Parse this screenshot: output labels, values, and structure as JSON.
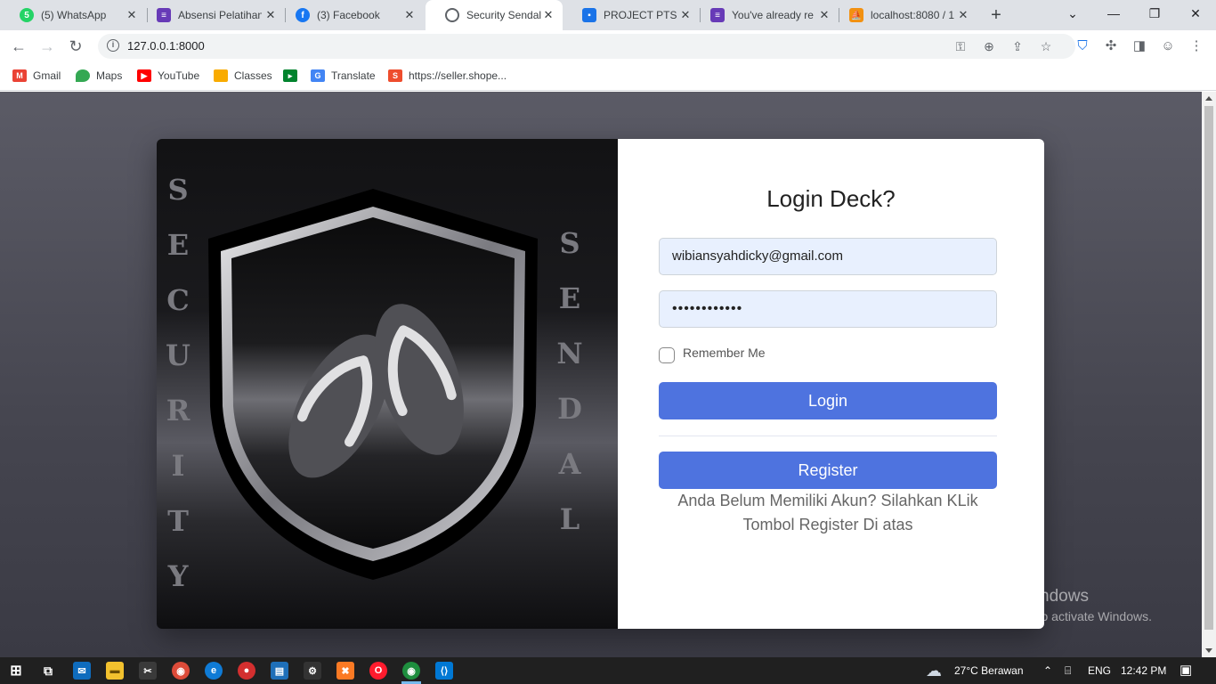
{
  "browser": {
    "tabs": [
      {
        "title": "(5) WhatsApp",
        "favicon": "whatsapp-icon",
        "color": "#25d366"
      },
      {
        "title": "Absensi Pelatihan",
        "favicon": "forms-icon",
        "color": "#673ab7"
      },
      {
        "title": "(3) Facebook",
        "favicon": "facebook-icon",
        "color": "#1877f2"
      },
      {
        "title": "Security Sendal",
        "favicon": "globe-icon",
        "color": "#5f6368",
        "active": true
      },
      {
        "title": "PROJECT PTS",
        "favicon": "classroom-icon",
        "color": "#1a73e8"
      },
      {
        "title": "You've already re",
        "favicon": "forms-icon",
        "color": "#673ab7"
      },
      {
        "title": "localhost:8080 / 1",
        "favicon": "phpmyadmin-icon",
        "color": "#f29111"
      }
    ],
    "new_tab": "+",
    "window_controls": {
      "tab_search": "⌄",
      "minimize": "—",
      "restore": "❐",
      "close": "✕"
    },
    "address": "127.0.0.1:8000",
    "bookmarks": [
      {
        "label": "Gmail",
        "icon": "gmail-icon",
        "color": "#ea4335"
      },
      {
        "label": "Maps",
        "icon": "maps-icon",
        "color": "#34a853"
      },
      {
        "label": "YouTube",
        "icon": "youtube-icon",
        "color": "#ff0000"
      },
      {
        "label": "Classes",
        "icon": "classroom-icon",
        "color": "#f9ab00"
      },
      {
        "label": "",
        "icon": "meet-icon",
        "color": "#00832d"
      },
      {
        "label": "Translate",
        "icon": "translate-icon",
        "color": "#4285f4"
      },
      {
        "label": "https://seller.shope...",
        "icon": "shopee-icon",
        "color": "#ee4d2d"
      }
    ]
  },
  "hero": {
    "left_letters": [
      "S",
      "E",
      "C",
      "U",
      "R",
      "I",
      "T",
      "Y"
    ],
    "right_letters": [
      "S",
      "E",
      "N",
      "D",
      "A",
      "L"
    ]
  },
  "login": {
    "title": "Login Deck?",
    "email_value": "wibiansyahdicky@gmail.com",
    "password_value": "••••••••••••",
    "remember_label": "Remember Me",
    "remember_checked": false,
    "login_button": "Login",
    "register_button": "Register",
    "help_text": "Anda Belum Memiliki Akun? Silahkan KLik Tombol Register Di atas"
  },
  "watermark": {
    "line1": "Activate Windows",
    "line2": "Go to Settings to activate Windows."
  },
  "taskbar": {
    "weather": "27°C  Berawan",
    "language": "ENG",
    "time": "12:42 PM"
  },
  "colors": {
    "primary": "#4e73df",
    "input_bg": "#e8f0fe"
  }
}
